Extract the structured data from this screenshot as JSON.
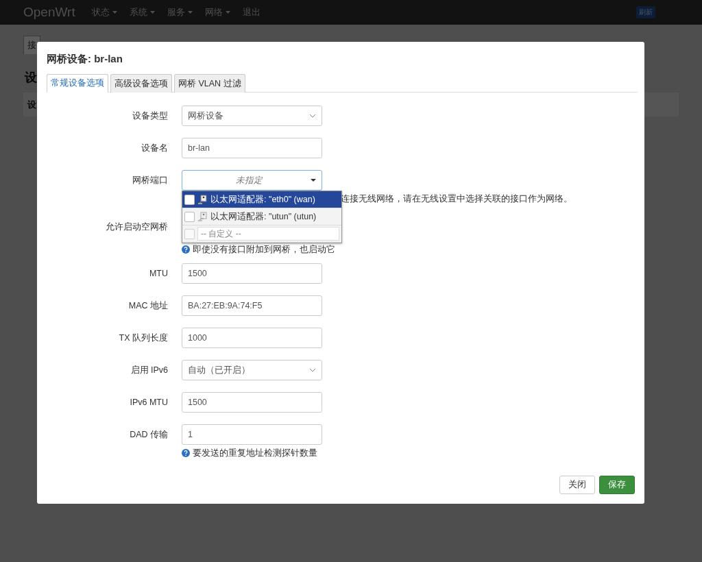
{
  "navbar": {
    "brand": "OpenWrt",
    "menu": [
      {
        "label": "状态",
        "has_caret": true
      },
      {
        "label": "系统",
        "has_caret": true
      },
      {
        "label": "服务",
        "has_caret": true
      },
      {
        "label": "网络",
        "has_caret": true
      },
      {
        "label": "退出",
        "has_caret": false
      }
    ],
    "badge": "刷新"
  },
  "background": {
    "tab": "接",
    "heading": "设",
    "column": "设"
  },
  "dialog": {
    "title": "网桥设备: br-lan",
    "tabs": [
      {
        "label": "常规设备选项",
        "selected": true
      },
      {
        "label": "高级设备选项",
        "selected": false
      },
      {
        "label": "网桥 VLAN 过滤",
        "selected": false
      }
    ],
    "fields": [
      {
        "kind": "select",
        "label": "设备类型",
        "value": "网桥设备"
      },
      {
        "kind": "input",
        "label": "设备名",
        "value": "br-lan"
      },
      {
        "kind": "multiselect",
        "label": "网桥端口",
        "placeholder": "未指定",
        "help": "连接无线网络，请在无线设置中选择关联的接口作为网络。",
        "options": [
          {
            "kind": "adapter",
            "label": "以太网适配器: \"eth0\" (wan)",
            "checked": false,
            "selected": true
          },
          {
            "kind": "adapter",
            "label": "以太网适配器: \"utun\" (utun)",
            "checked": false,
            "selected": false
          },
          {
            "kind": "custom",
            "placeholder": "-- 自定义 --",
            "checked": false,
            "selected": false
          }
        ]
      },
      {
        "kind": "checkbox",
        "label": "允许启动空网桥",
        "help": "即使没有接口附加到网桥，也启动它"
      },
      {
        "kind": "input",
        "label": "MTU",
        "value": "1500"
      },
      {
        "kind": "input",
        "label": "MAC 地址",
        "value": "BA:27:EB:9A:74:F5"
      },
      {
        "kind": "input",
        "label": "TX 队列长度",
        "value": "1000"
      },
      {
        "kind": "select",
        "label": "启用 IPv6",
        "value": "自动（已开启）"
      },
      {
        "kind": "input",
        "label": "IPv6 MTU",
        "value": "1500"
      },
      {
        "kind": "input",
        "label": "DAD 传输",
        "value": "1",
        "help": "要发送的重复地址检测探针数量"
      }
    ],
    "buttons": [
      {
        "kind": "plain",
        "label": "关闭"
      },
      {
        "kind": "primary",
        "label": "保存"
      }
    ]
  }
}
